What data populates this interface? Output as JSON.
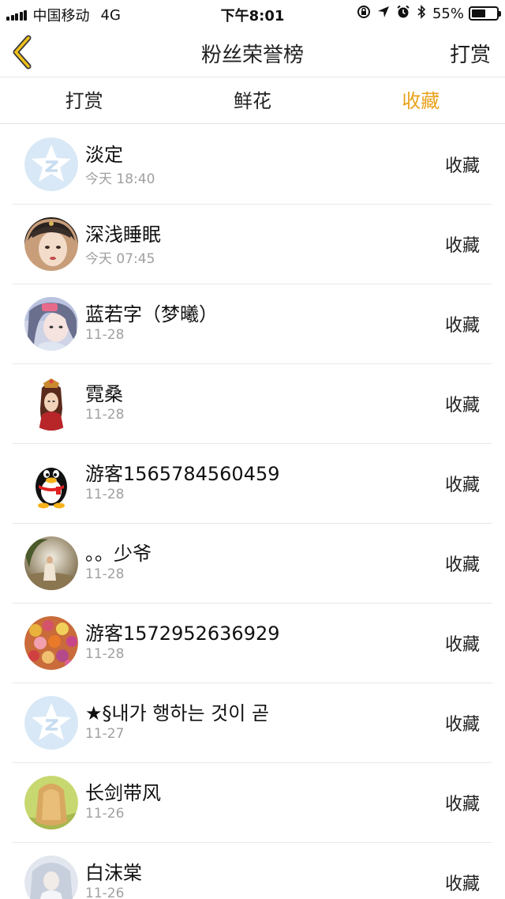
{
  "status_bar": {
    "carrier": "中国移动",
    "network": "4G",
    "time": "下午8:01",
    "battery": "55%",
    "battery_level": 0.55
  },
  "nav": {
    "title": "粉丝荣誉榜",
    "action_label": "打赏",
    "back_icon": "chevron-left-icon"
  },
  "tabs": [
    {
      "label": "打赏",
      "active": false
    },
    {
      "label": "鲜花",
      "active": false
    },
    {
      "label": "收藏",
      "active": true
    }
  ],
  "colors": {
    "accent": "#e8a21c",
    "divider": "#e8e8e8",
    "secondary_text": "#a0a0a0"
  },
  "fans": [
    {
      "name": "淡定",
      "time": "今天 18:40",
      "action": "收藏",
      "avatar": "default-avatar"
    },
    {
      "name": "深浅睡眠",
      "time": "今天 07:45",
      "action": "收藏",
      "avatar": "photo-avatar"
    },
    {
      "name": "蓝若字（梦曦）",
      "time": "11-28",
      "action": "收藏",
      "avatar": "photo-avatar"
    },
    {
      "name": "霓桑",
      "time": "11-28",
      "action": "收藏",
      "avatar": "photo-avatar"
    },
    {
      "name": "游客1565784560459",
      "time": "11-28",
      "action": "收藏",
      "avatar": "penguin-avatar"
    },
    {
      "name": "。。少爷",
      "time": "11-28",
      "action": "收藏",
      "avatar": "photo-avatar"
    },
    {
      "name": "游客1572952636929",
      "time": "11-28",
      "action": "收藏",
      "avatar": "photo-avatar"
    },
    {
      "name": "★§내가 행하는 것이 곧",
      "time": "11-27",
      "action": "收藏",
      "avatar": "default-avatar"
    },
    {
      "name": "长剑带风",
      "time": "11-26",
      "action": "收藏",
      "avatar": "photo-avatar"
    },
    {
      "name": "白沫棠",
      "time": "11-26",
      "action": "收藏",
      "avatar": "photo-avatar"
    }
  ]
}
